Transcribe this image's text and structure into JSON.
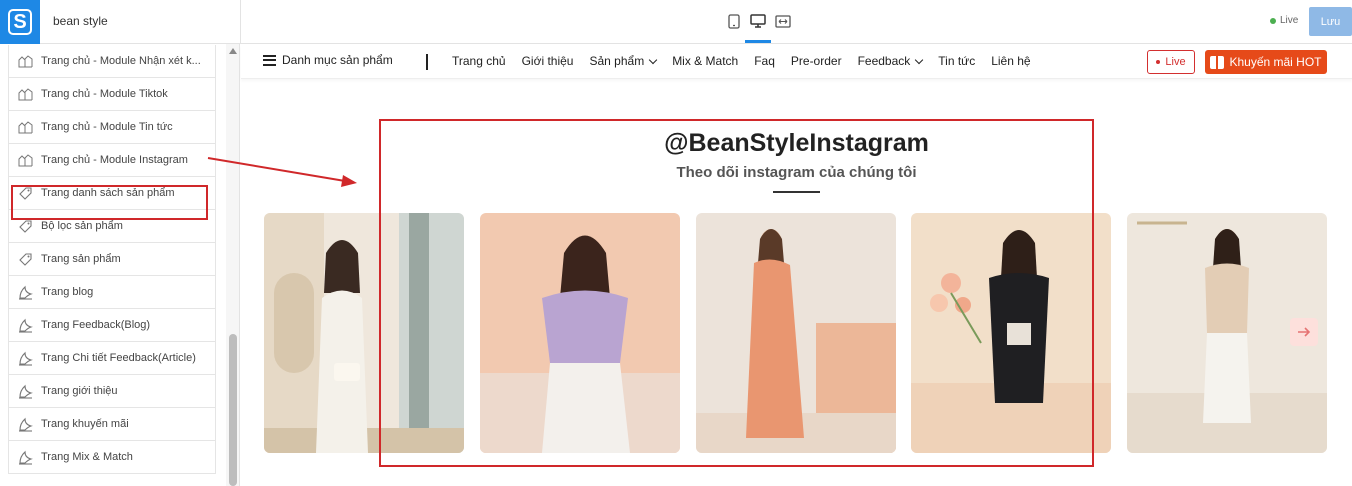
{
  "app": {
    "site_name": "bean style",
    "live_label": "Live",
    "save_label": "Lưu"
  },
  "sidebar": {
    "items": [
      {
        "label": "Trang chủ - Module Nhận xét k...",
        "icon": "layout-icon"
      },
      {
        "label": "Trang chủ - Module Tiktok",
        "icon": "layout-icon"
      },
      {
        "label": "Trang chủ - Module Tin tức",
        "icon": "layout-icon"
      },
      {
        "label": "Trang chủ - Module Instagram",
        "icon": "layout-icon"
      },
      {
        "label": "Trang danh sách sản phẩm",
        "icon": "tag-icon"
      },
      {
        "label": "Bộ lọc sản phẩm",
        "icon": "tag-icon"
      },
      {
        "label": "Trang sản phẩm",
        "icon": "tag-icon"
      },
      {
        "label": "Trang blog",
        "icon": "blog-icon"
      },
      {
        "label": "Trang Feedback(Blog)",
        "icon": "blog-icon"
      },
      {
        "label": "Trang Chi tiết Feedback(Article)",
        "icon": "blog-icon"
      },
      {
        "label": "Trang giới thiệu",
        "icon": "blog-icon"
      },
      {
        "label": "Trang khuyến mãi",
        "icon": "blog-icon"
      },
      {
        "label": "Trang Mix & Match",
        "icon": "blog-icon"
      }
    ]
  },
  "store_nav": {
    "category_menu": "Danh mục sản phẩm",
    "items": [
      "Trang chủ",
      "Giới thiệu",
      "Sản phẩm",
      "Mix & Match",
      "Faq",
      "Pre-order",
      "Feedback",
      "Tin tức",
      "Liên hệ"
    ],
    "live_button": "Live",
    "promo_button": "Khuyến mãi HOT"
  },
  "instagram_section": {
    "title": "@BeanStyleInstagram",
    "subtitle": "Theo dõi instagram của chúng tôi"
  },
  "colors": {
    "accent": "#1e88e5",
    "highlight": "#d0282a",
    "promo": "#e64a19"
  }
}
